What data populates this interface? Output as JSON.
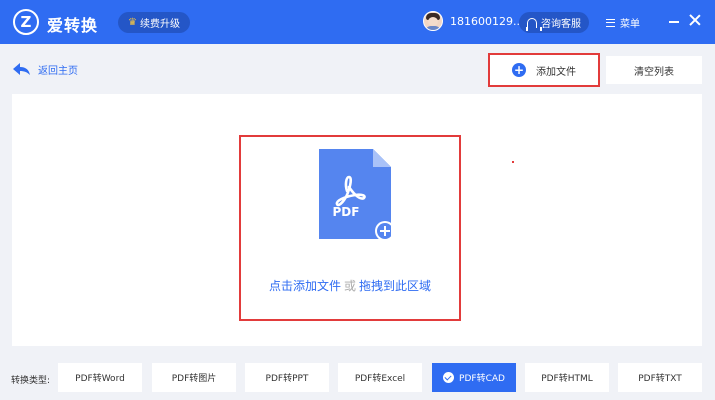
{
  "header": {
    "logo_letter": "Z",
    "app_title": "爱转换",
    "upgrade_label": "续费升级",
    "user_phone": "181600129...",
    "service_label": "咨询客服",
    "menu_label": "菜单"
  },
  "toolbar": {
    "back_label": "返回主页",
    "add_file_label": "添加文件",
    "clear_list_label": "清空列表"
  },
  "drop_zone": {
    "doc_label": "PDF",
    "click_add": "点击添加文件",
    "or": "或",
    "drag_here": "拖拽到此区域"
  },
  "convert": {
    "type_label": "转换类型:",
    "types": [
      {
        "label": "PDF转Word"
      },
      {
        "label": "PDF转图片"
      },
      {
        "label": "PDF转PPT"
      },
      {
        "label": "PDF转Excel"
      },
      {
        "label": "PDF转CAD"
      },
      {
        "label": "PDF转HTML"
      },
      {
        "label": "PDF转TXT"
      }
    ],
    "selected": "PDF转CAD"
  },
  "colors": {
    "brand_blue": "#2f6cf2",
    "highlight_red": "#e23b3b",
    "pdf_icon_blue": "#5585ef"
  }
}
